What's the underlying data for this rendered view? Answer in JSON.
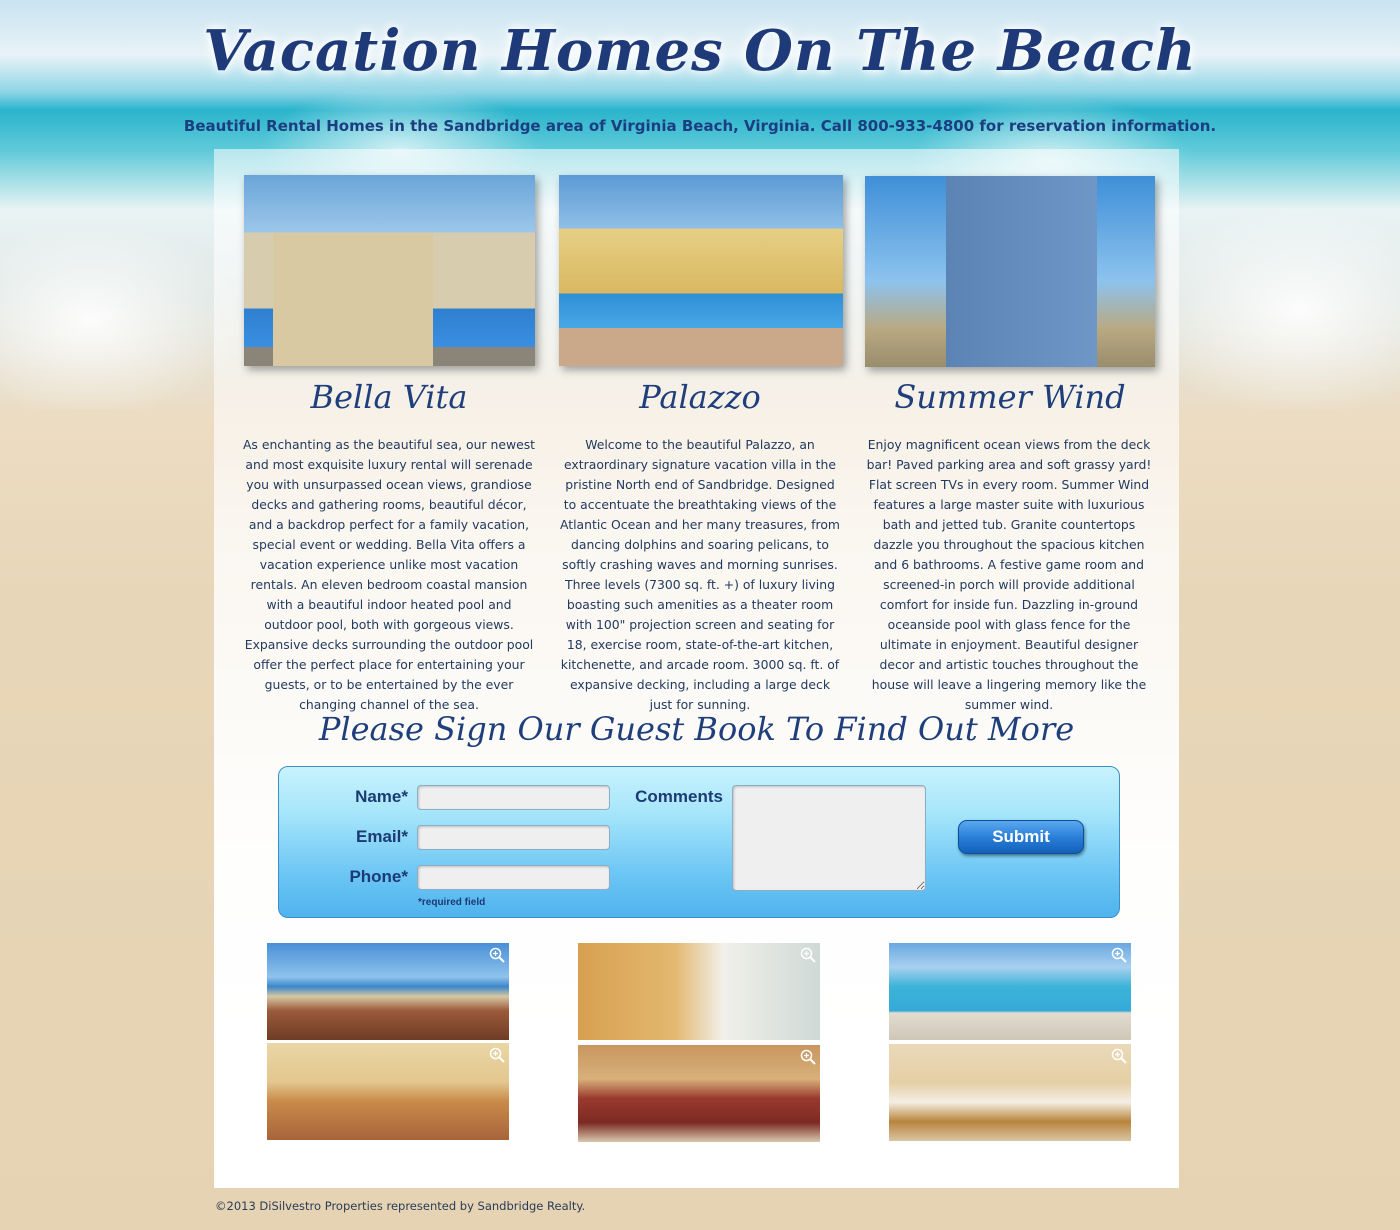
{
  "header": {
    "title": "Vacation Homes On The Beach",
    "tagline": "Beautiful Rental Homes in the Sandbridge area of Virginia Beach, Virginia. Call 800-933-4800 for reservation information."
  },
  "properties": [
    {
      "name": "Bella Vita",
      "description": "As enchanting as the beautiful sea, our newest and most exquisite luxury rental will serenade you with unsurpassed ocean views, grandiose decks and gathering rooms, beautiful décor, and a backdrop perfect for a family vacation, special event or wedding. Bella Vita offers a vacation experience unlike most vacation rentals. An eleven bedroom coastal mansion with a beautiful indoor heated pool and outdoor pool, both with gorgeous views. Expansive decks surrounding the outdoor pool offer the perfect place for entertaining your guests, or to be entertained by the ever changing channel of the sea."
    },
    {
      "name": "Palazzo",
      "description": "Welcome to the beautiful Palazzo, an extraordinary signature vacation villa in the pristine North end of Sandbridge. Designed to accentuate the breathtaking views of the Atlantic Ocean and her many treasures, from dancing dolphins and soaring pelicans, to softly crashing waves and morning sunrises. Three levels (7300 sq. ft. +) of luxury living boasting such amenities as a theater room with 100\" projection screen and seating for 18, exercise room, state-of-the-art kitchen, kitchenette, and arcade room. 3000 sq. ft. of expansive decking, including a large deck just for sunning."
    },
    {
      "name": "Summer Wind",
      "description": "Enjoy magnificent ocean views from the deck bar! Paved parking area and soft grassy yard! Flat screen TVs in every room. Summer Wind features a large master suite with luxurious bath and jetted tub. Granite countertops dazzle you throughout the spacious kitchen and 6 bathrooms. A festive game room and screened-in porch will provide additional comfort for inside fun. Dazzling in-ground oceanside pool with glass fence for the ultimate in enjoyment. Beautiful designer decor and artistic touches throughout the house will leave a lingering memory like the summer wind."
    }
  ],
  "guestbook": {
    "title": "Please Sign Our Guest Book To Find Out More",
    "name_label": "Name*",
    "email_label": "Email*",
    "phone_label": "Phone*",
    "comments_label": "Comments",
    "name_value": "",
    "email_value": "",
    "phone_value": "",
    "comments_value": "",
    "required_note": "*required field",
    "submit_label": "Submit"
  },
  "gallery": {
    "icon": "zoom-in-icon",
    "thumbnails": [
      {
        "scene": "ocean-deck"
      },
      {
        "scene": "kitchen"
      },
      {
        "scene": "pool"
      },
      {
        "scene": "living-room"
      },
      {
        "scene": "family-room"
      },
      {
        "scene": "great-room"
      }
    ]
  },
  "footer": {
    "copyright": "©2013 DiSilvestro Properties represented by Sandbridge Realty."
  },
  "colors": {
    "heading": "#1f3f7c",
    "form_background": "#6ec7f4",
    "submit_button": "#2a7fd8"
  }
}
